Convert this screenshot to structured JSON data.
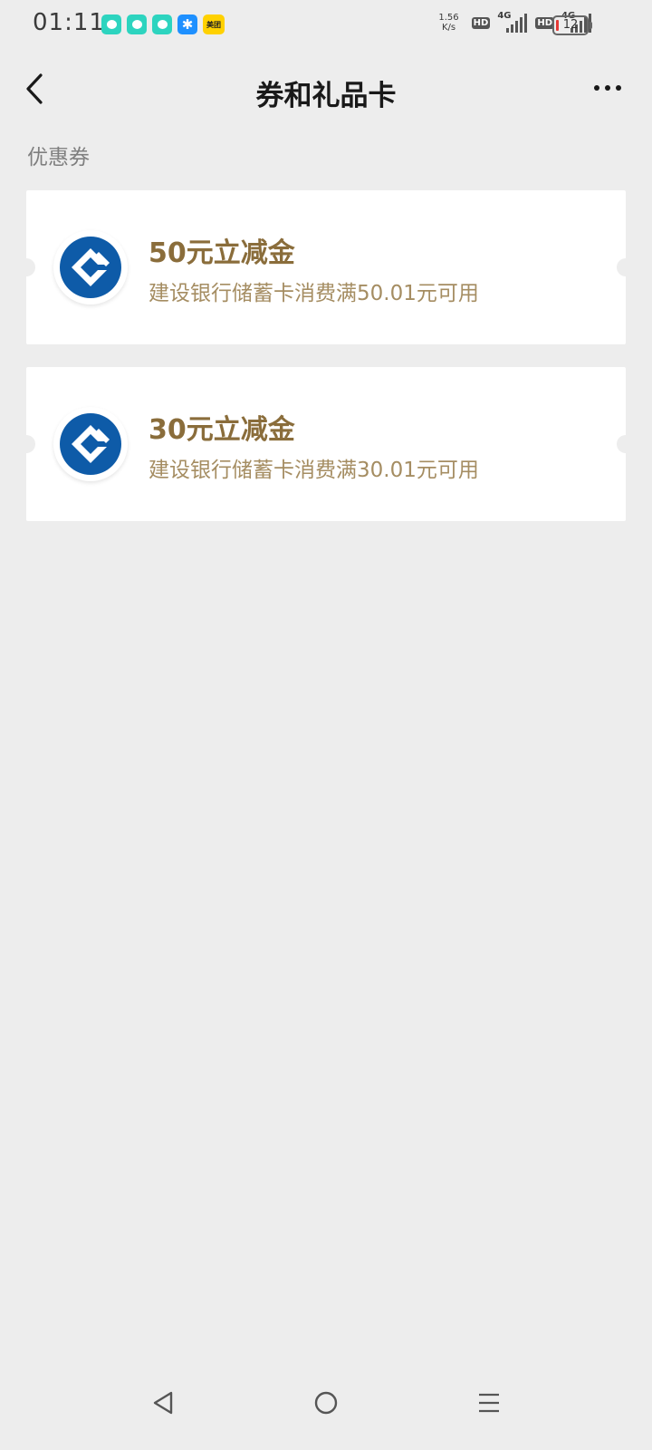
{
  "status_bar": {
    "time": "01:11",
    "net_speed_value": "1.56",
    "net_speed_unit": "K/s",
    "hd_label": "HD",
    "network_label": "4G",
    "battery_level": "12",
    "notification_icons": [
      "chat-icon",
      "chat-icon",
      "chat-icon",
      "puzzle-icon",
      "meituan-icon"
    ],
    "meituan_label": "美团"
  },
  "nav": {
    "title": "券和礼品卡",
    "back_icon": "chevron-left-icon",
    "more_icon": "more-dots-icon"
  },
  "section": {
    "title": "优惠券"
  },
  "coupons": [
    {
      "title": "50元立减金",
      "description": "建设银行储蓄卡消费满50.01元可用",
      "logo": "ccb-bank-logo"
    },
    {
      "title": "30元立减金",
      "description": "建设银行储蓄卡消费满30.01元可用",
      "logo": "ccb-bank-logo"
    }
  ],
  "colors": {
    "background": "#ededed",
    "card": "#ffffff",
    "coupon_title": "#8a6d3b",
    "coupon_desc": "#a58d62",
    "logo_blue": "#0e5ba8"
  }
}
